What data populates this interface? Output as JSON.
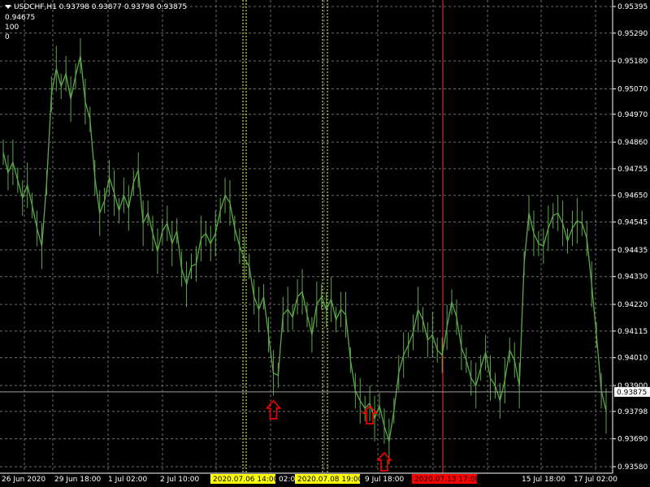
{
  "header": {
    "symbol_line": "USDCHF,H1  0.93798 0.93877 0.93798 0.93875",
    "indicator_value": "0.94675",
    "level_high": "100",
    "level_low": "0"
  },
  "chart_data": {
    "type": "line",
    "title": "USDCHF,H1",
    "ohlc_last": {
      "open": 0.93798,
      "high": 0.93877,
      "low": 0.93798,
      "close": 0.93875
    },
    "ylim": [
      0.9358,
      0.95395
    ],
    "y_ticks": [
      "0.95395",
      "0.95290",
      "0.95180",
      "0.95070",
      "0.94970",
      "0.94860",
      "0.94755",
      "0.94650",
      "0.94545",
      "0.94435",
      "0.94330",
      "0.94220",
      "0.94115",
      "0.94010",
      "0.93900",
      "0.93798",
      "0.93690",
      "0.93580"
    ],
    "x_tick_labels": [
      "26 Jun 2020",
      "29 Jun 18:00",
      "1 Jul 02:00",
      "2 Jul 10:00",
      "02:00",
      "9 Jul 18:00",
      "15 Jul 18:00",
      "17 Jul 02:00"
    ],
    "x_highlight_labels": [
      {
        "text": "2020.07.06 14:00",
        "bg": "#ffff00",
        "fg": "#000000"
      },
      {
        "text": "2020.07.08 19:00",
        "bg": "#ffff00",
        "fg": "#000000"
      },
      {
        "text": "2020.07.13 17:00",
        "bg": "#ff0000",
        "fg": "#000000"
      }
    ],
    "current_price_label": "0.93875",
    "series_color": "#5ca84a",
    "arrow_color": "#ff0000",
    "grid": true,
    "series": [
      {
        "values": [
          0.9482,
          0.9474,
          0.9478,
          0.9471,
          0.9464,
          0.9469,
          0.9461,
          0.9452,
          0.9445,
          0.947,
          0.9505,
          0.9515,
          0.9508,
          0.9513,
          0.9503,
          0.9512,
          0.952,
          0.9502,
          0.9495,
          0.9472,
          0.9458,
          0.9463,
          0.9472,
          0.9466,
          0.9459,
          0.9465,
          0.946,
          0.947,
          0.9475,
          0.9454,
          0.9458,
          0.945,
          0.9443,
          0.9451,
          0.9454,
          0.9446,
          0.9451,
          0.9436,
          0.943,
          0.9437,
          0.9438,
          0.9448,
          0.945,
          0.9446,
          0.945,
          0.9459,
          0.9465,
          0.9462,
          0.9452,
          0.9445,
          0.944,
          0.9437,
          0.9425,
          0.942,
          0.9425,
          0.941,
          0.9395,
          0.9394,
          0.9418,
          0.942,
          0.9417,
          0.9425,
          0.9427,
          0.9418,
          0.941,
          0.9422,
          0.9425,
          0.942,
          0.9424,
          0.9416,
          0.942,
          0.9418,
          0.94,
          0.9388,
          0.9384,
          0.9381,
          0.9383,
          0.9377,
          0.9382,
          0.9374,
          0.9368,
          0.938,
          0.9395,
          0.9402,
          0.9406,
          0.9411,
          0.942,
          0.9416,
          0.9408,
          0.941,
          0.9404,
          0.9402,
          0.9413,
          0.9423,
          0.9417,
          0.9405,
          0.94,
          0.9393,
          0.939,
          0.9397,
          0.9403,
          0.9393,
          0.939,
          0.9384,
          0.9392,
          0.9404,
          0.94,
          0.939,
          0.9438,
          0.9458,
          0.945,
          0.9446,
          0.9445,
          0.9452,
          0.9457,
          0.9458,
          0.9454,
          0.9447,
          0.9452,
          0.9455,
          0.9454,
          0.9448,
          0.943,
          0.941,
          0.9388,
          0.938
        ],
        "up_arrows": [
          {
            "index": 56,
            "price": 0.9384
          },
          {
            "index": 76,
            "price": 0.9382
          },
          {
            "index": 79,
            "price": 0.93635
          }
        ]
      }
    ]
  }
}
